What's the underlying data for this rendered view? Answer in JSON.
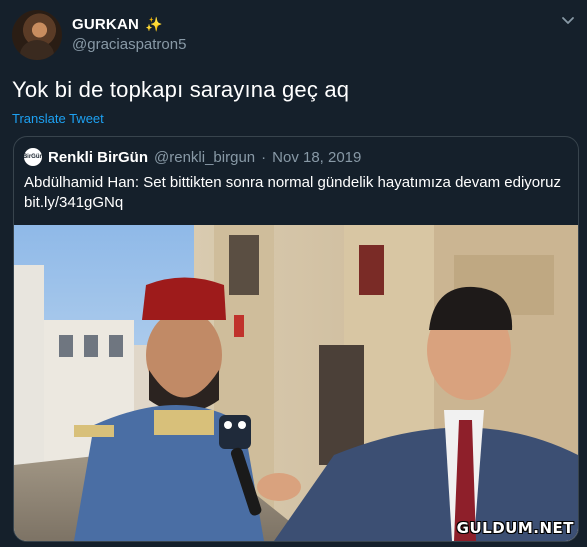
{
  "author": {
    "display_name": "GURKAN",
    "badge_emoji": "✨",
    "handle": "@graciaspatron5",
    "avatar_icon": "user-avatar"
  },
  "tweet": {
    "text": "Yok bi de topkapı sarayına geç aq",
    "translate_label": "Translate Tweet"
  },
  "quoted_tweet": {
    "avatar_label": "BirGün",
    "display_name": "Renkli BirGün",
    "handle": "@renkli_birgun",
    "separator": " · ",
    "date": "Nov 18, 2019",
    "text": "Abdülhamid Han: Set bittikten sonra normal gündelik hayatımıza devam ediyoruz bit.ly/341gGNq"
  },
  "watermark": "GULDUM.NET",
  "colors": {
    "background": "#15202b",
    "accent": "#1da1f2",
    "muted": "#8899a6",
    "border": "#38444d"
  }
}
